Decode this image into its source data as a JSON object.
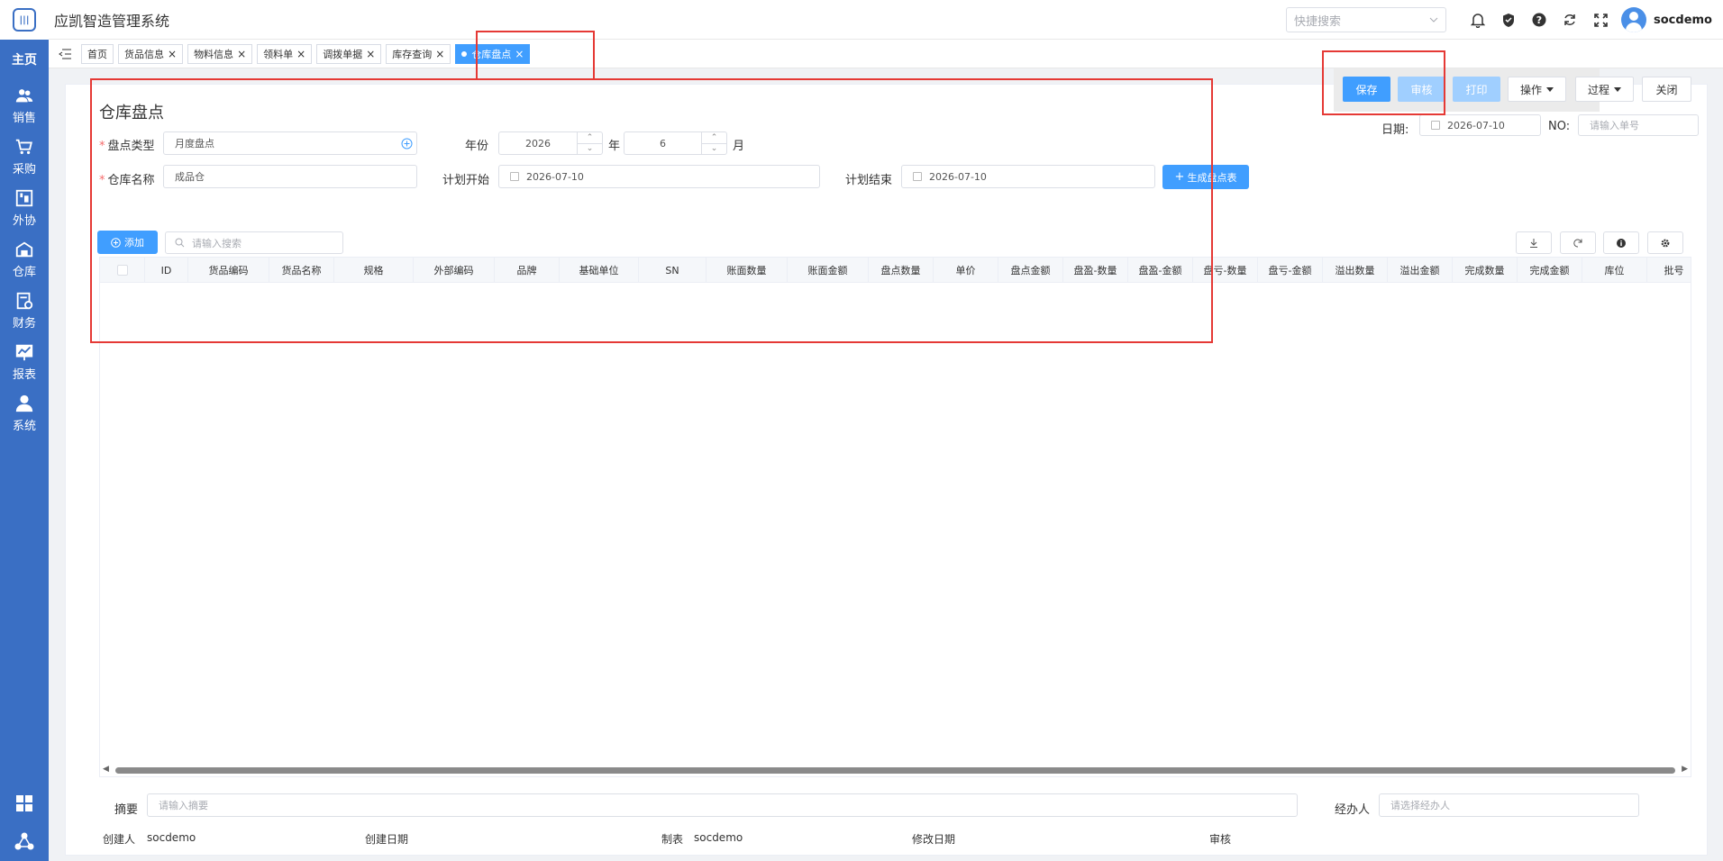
{
  "app": {
    "title": "应凯智造管理系统",
    "logo_text": "|||"
  },
  "sidebar": {
    "home": "主页",
    "items": [
      {
        "label": "销售",
        "icon": "users-icon"
      },
      {
        "label": "采购",
        "icon": "cart-icon"
      },
      {
        "label": "外协",
        "icon": "outsource-icon"
      },
      {
        "label": "仓库",
        "icon": "warehouse-icon"
      },
      {
        "label": "财务",
        "icon": "finance-icon"
      },
      {
        "label": "报表",
        "icon": "report-icon"
      },
      {
        "label": "系统",
        "icon": "user-icon"
      }
    ]
  },
  "header": {
    "quick_search_placeholder": "快捷搜索",
    "username": "socdemo"
  },
  "tabs": [
    {
      "label": "首页",
      "closable": false,
      "active": false
    },
    {
      "label": "货品信息",
      "closable": true,
      "active": false
    },
    {
      "label": "物料信息",
      "closable": true,
      "active": false
    },
    {
      "label": "领料单",
      "closable": true,
      "active": false
    },
    {
      "label": "调拨单据",
      "closable": true,
      "active": false
    },
    {
      "label": "库存查询",
      "closable": true,
      "active": false
    },
    {
      "label": "仓库盘点",
      "closable": true,
      "active": true
    }
  ],
  "close_glyph": "×",
  "page": {
    "title": "仓库盘点"
  },
  "toolbar": {
    "save": "保存",
    "audit": "审核",
    "print": "打印",
    "operate": "操作",
    "process": "过程",
    "close": "关闭"
  },
  "meta": {
    "date_label": "日期:",
    "date_value": "2026-07-10",
    "no_label": "NO:",
    "no_placeholder": "请输入单号"
  },
  "form": {
    "check_type_label": "盘点类型",
    "check_type_value": "月度盘点",
    "year_label": "年份",
    "year_value": "2026",
    "year_unit": "年",
    "month_value": "6",
    "month_unit": "月",
    "warehouse_label": "仓库名称",
    "warehouse_value": "成品仓",
    "plan_start_label": "计划开始",
    "plan_start_value": "2026-07-10",
    "plan_end_label": "计划结束",
    "plan_end_value": "2026-07-10",
    "generate_button": "生成盘点表"
  },
  "table_toolbar": {
    "add_button": "添加",
    "search_placeholder": "请输入搜索"
  },
  "table": {
    "columns": [
      "ID",
      "货品编码",
      "货品名称",
      "规格",
      "外部编码",
      "品牌",
      "基础单位",
      "SN",
      "账面数量",
      "账面金额",
      "盘点数量",
      "单价",
      "盘点金额",
      "盘盈-数量",
      "盘盈-金额",
      "盘亏-数量",
      "盘亏-金额",
      "溢出数量",
      "溢出金额",
      "完成数量",
      "完成金额",
      "库位",
      "批号"
    ],
    "rows": []
  },
  "footer": {
    "summary_label": "摘要",
    "summary_placeholder": "请输入摘要",
    "handler_label": "经办人",
    "handler_placeholder": "请选择经办人",
    "creator_label": "创建人",
    "creator_value": "socdemo",
    "created_date_label": "创建日期",
    "maker_label": "制表",
    "maker_value": "socdemo",
    "modified_date_label": "修改日期",
    "auditor_label": "审核"
  },
  "colors": {
    "primary": "#409eff",
    "sidebar": "#3a6fc4",
    "annotation": "#e53935"
  }
}
